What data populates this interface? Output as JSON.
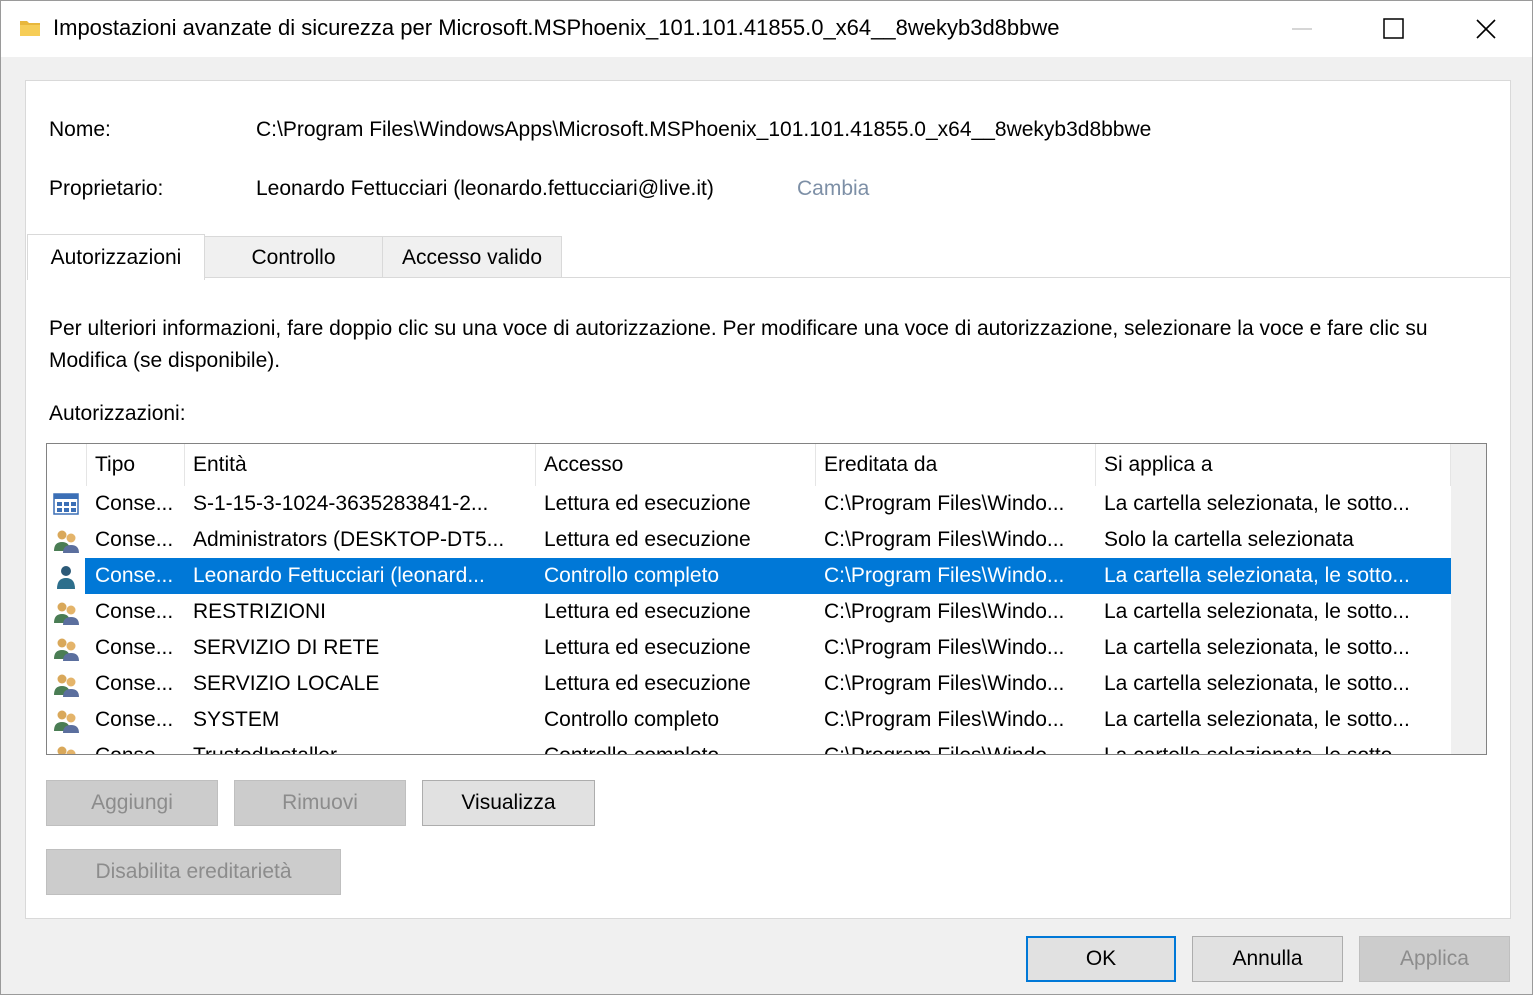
{
  "window": {
    "title": "Impostazioni avanzate di sicurezza per Microsoft.MSPhoenix_101.101.41855.0_x64__8wekyb3d8bbwe",
    "icon": "folder-icon"
  },
  "info": {
    "name_label": "Nome:",
    "name_value": "C:\\Program Files\\WindowsApps\\Microsoft.MSPhoenix_101.101.41855.0_x64__8wekyb3d8bbwe",
    "owner_label": "Proprietario:",
    "owner_value": "Leonardo Fettucciari (leonardo.fettucciari@live.it)",
    "change_link": "Cambia"
  },
  "tabs": [
    {
      "label": "Autorizzazioni",
      "active": true
    },
    {
      "label": "Controllo",
      "active": false
    },
    {
      "label": "Accesso valido",
      "active": false
    }
  ],
  "description": "Per ulteriori informazioni, fare doppio clic su una voce di autorizzazione. Per modificare una voce di autorizzazione, selezionare la voce e fare clic su Modifica (se disponibile).",
  "permissions_label": "Autorizzazioni:",
  "columns": [
    "Tipo",
    "Entità",
    "Accesso",
    "Ereditata da",
    "Si applica a"
  ],
  "rows": [
    {
      "icon": "app-package-icon",
      "tipo": "Conse...",
      "entita": "S-1-15-3-1024-3635283841-2...",
      "accesso": "Lettura ed esecuzione",
      "ereditata": "C:\\Program Files\\Windo...",
      "applica": "La cartella selezionata, le sotto...",
      "selected": false
    },
    {
      "icon": "group-icon",
      "tipo": "Conse...",
      "entita": "Administrators (DESKTOP-DT5...",
      "accesso": "Lettura ed esecuzione",
      "ereditata": "C:\\Program Files\\Windo...",
      "applica": "Solo la cartella selezionata",
      "selected": false
    },
    {
      "icon": "user-icon",
      "tipo": "Conse...",
      "entita": "Leonardo Fettucciari (leonard...",
      "accesso": "Controllo completo",
      "ereditata": "C:\\Program Files\\Windo...",
      "applica": "La cartella selezionata, le sotto...",
      "selected": true
    },
    {
      "icon": "group-icon",
      "tipo": "Conse...",
      "entita": "RESTRIZIONI",
      "accesso": "Lettura ed esecuzione",
      "ereditata": "C:\\Program Files\\Windo...",
      "applica": "La cartella selezionata, le sotto...",
      "selected": false
    },
    {
      "icon": "group-icon",
      "tipo": "Conse...",
      "entita": "SERVIZIO DI RETE",
      "accesso": "Lettura ed esecuzione",
      "ereditata": "C:\\Program Files\\Windo...",
      "applica": "La cartella selezionata, le sotto...",
      "selected": false
    },
    {
      "icon": "group-icon",
      "tipo": "Conse...",
      "entita": "SERVIZIO LOCALE",
      "accesso": "Lettura ed esecuzione",
      "ereditata": "C:\\Program Files\\Windo...",
      "applica": "La cartella selezionata, le sotto...",
      "selected": false
    },
    {
      "icon": "group-icon",
      "tipo": "Conse...",
      "entita": "SYSTEM",
      "accesso": "Controllo completo",
      "ereditata": "C:\\Program Files\\Windo...",
      "applica": "La cartella selezionata, le sotto...",
      "selected": false
    },
    {
      "icon": "group-icon",
      "tipo": "Conse...",
      "entita": "TrustedInstaller",
      "accesso": "Controllo completo",
      "ereditata": "C:\\Program Files\\Windo...",
      "applica": "La cartella selezionata, le sotto...",
      "selected": false
    }
  ],
  "buttons": {
    "add": "Aggiungi",
    "remove": "Rimuovi",
    "view": "Visualizza",
    "disable_inheritance": "Disabilita ereditarietà",
    "ok": "OK",
    "cancel": "Annulla",
    "apply": "Applica"
  },
  "colors": {
    "selection": "#0078d7",
    "link": "#7d8fa6"
  }
}
